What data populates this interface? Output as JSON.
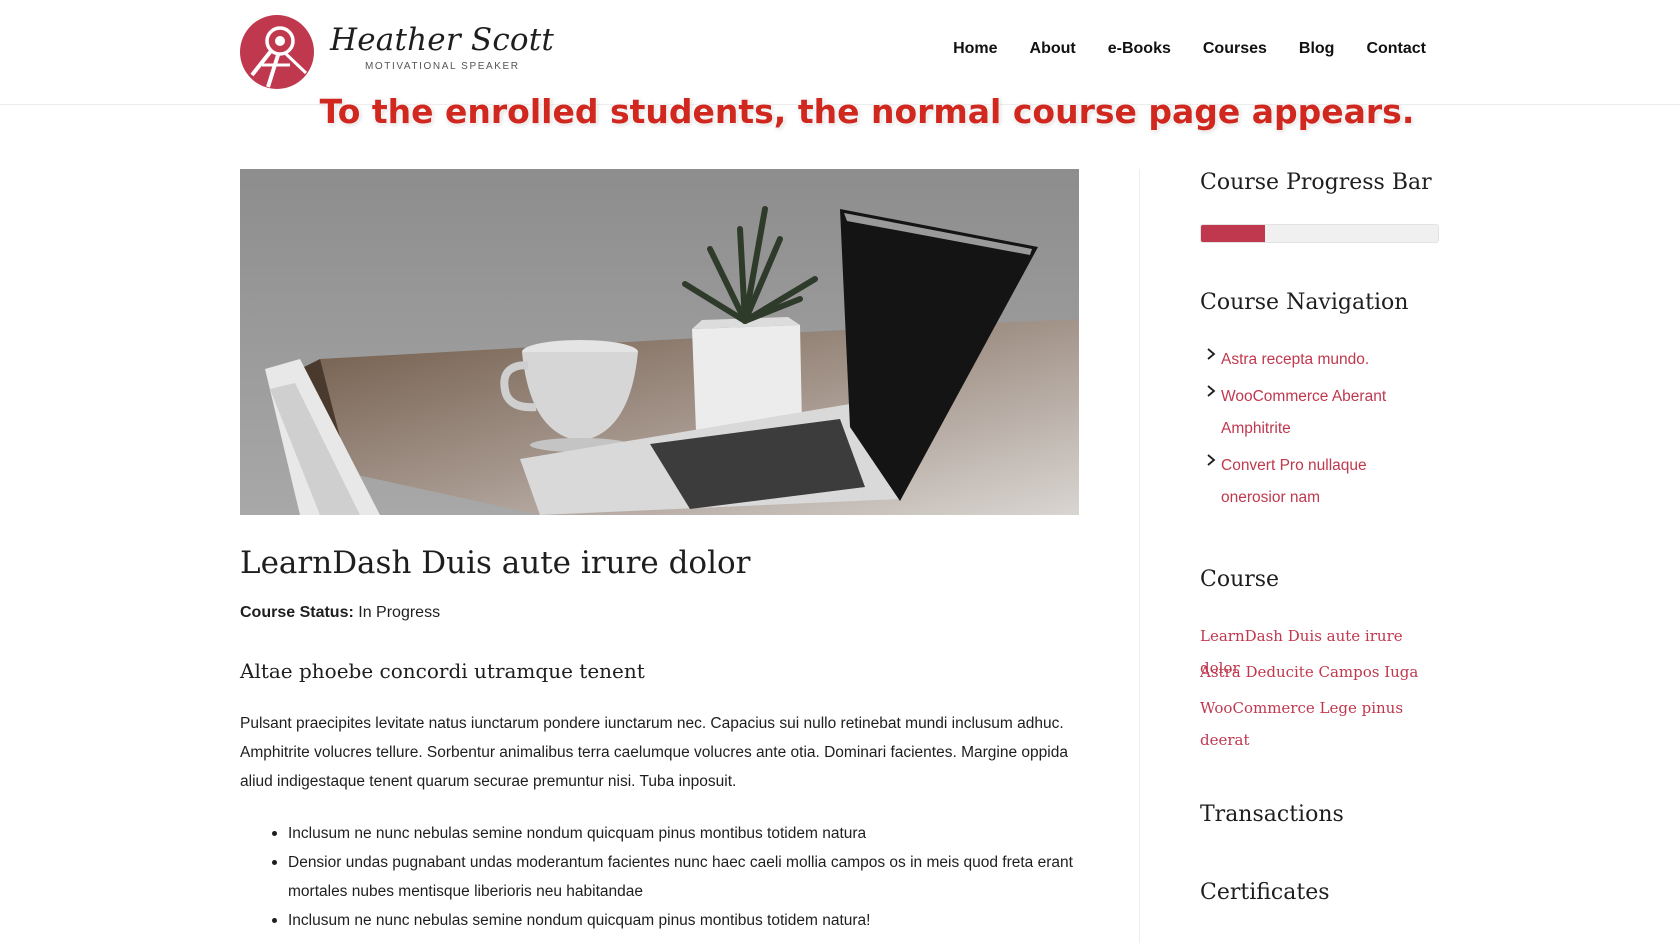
{
  "brand": {
    "name": "Heather Scott",
    "tagline": "MOTIVATIONAL SPEAKER",
    "accent": "#c0384e"
  },
  "nav": {
    "items": [
      {
        "label": "Home"
      },
      {
        "label": "About"
      },
      {
        "label": "e-Books"
      },
      {
        "label": "Courses"
      },
      {
        "label": "Blog"
      },
      {
        "label": "Contact"
      }
    ]
  },
  "banner": {
    "text": "To the enrolled students, the normal course page appears.",
    "color": "#d0271f"
  },
  "main": {
    "title": "LearnDash Duis aute irure dolor",
    "status_label": "Course Status:",
    "status_value": "In Progress",
    "subheading": "Altae phoebe concordi utramque tenent",
    "paragraph": "Pulsant praecipites levitate natus iunctarum pondere iunctarum nec. Capacius sui nullo retinebat mundi inclusum adhuc. Amphitrite volucres tellure. Sorbentur animalibus terra caelumque volucres ante otia. Dominari facientes. Margine oppida aliud indigestaque tenent quarum securae premuntur nisi. Tuba inposuit.",
    "bullets": [
      "Inclusum ne nunc nebulas semine nondum quicquam pinus montibus totidem natura",
      "Densior undas pugnabant undas moderantum facientes nunc haec caeli mollia campos os in meis quod freta erant mortales nubes mentisque liberioris neu habitandae",
      "Inclusum ne nunc nebulas semine nondum quicquam pinus montibus totidem natura!"
    ]
  },
  "sidebar": {
    "progress": {
      "title": "Course Progress Bar",
      "percent": 27
    },
    "course_navigation": {
      "title": "Course Navigation",
      "items": [
        "Astra recepta mundo.",
        "WooCommerce Aberant Amphitrite",
        "Convert Pro nullaque onerosior nam"
      ]
    },
    "course": {
      "title": "Course",
      "items": [
        "LearnDash Duis aute irure dolor",
        "Astra Deducite Campos Iuga",
        "WooCommerce Lege pinus deerat"
      ]
    },
    "transactions": {
      "title": "Transactions"
    },
    "certificates": {
      "title": "Certificates"
    }
  }
}
